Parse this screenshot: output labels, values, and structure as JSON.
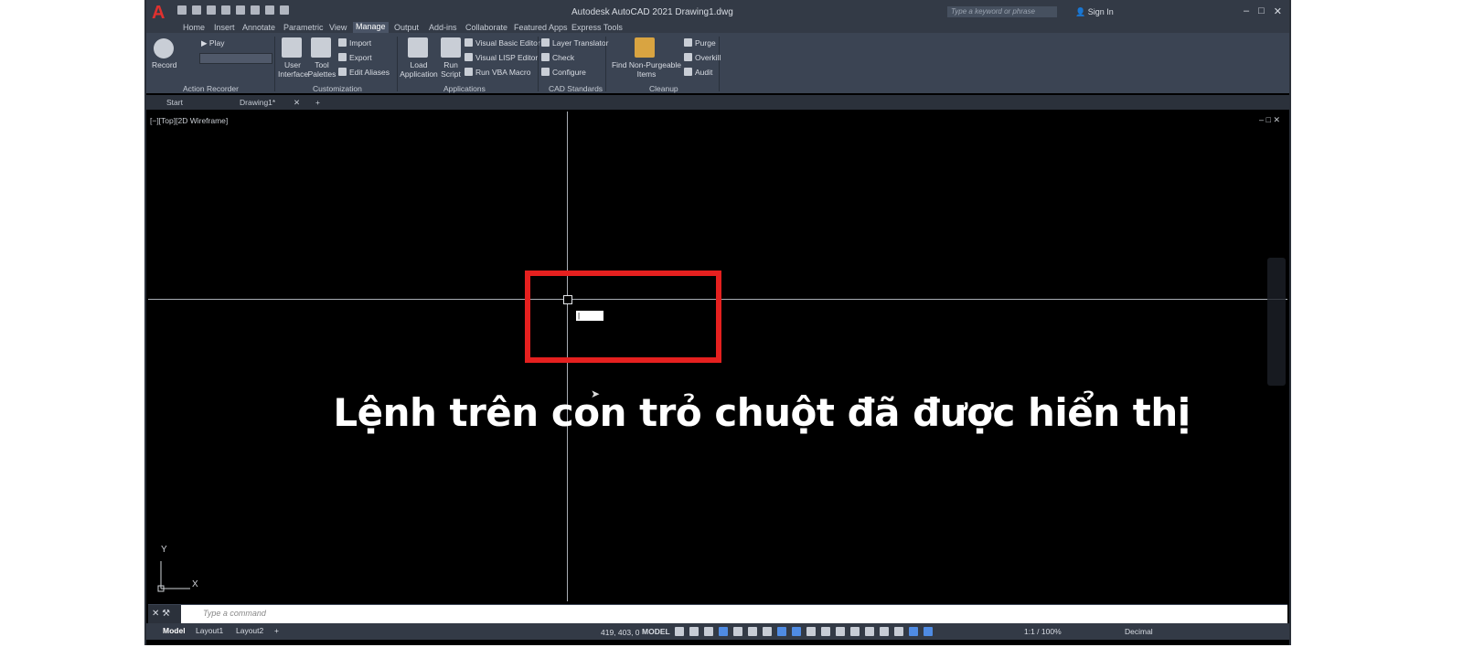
{
  "app": {
    "title": "Autodesk AutoCAD 2021   Drawing1.dwg",
    "logo_letter": "A",
    "search_placeholder": "Type a keyword or phrase",
    "sign_in": "Sign In"
  },
  "ribbon_tabs": [
    "Home",
    "Insert",
    "Annotate",
    "Parametric",
    "View",
    "Manage",
    "Output",
    "Add-ins",
    "Collaborate",
    "Featured Apps",
    "Express Tools"
  ],
  "active_tab": "Manage",
  "ribbon": {
    "record": "Record",
    "play": "Play",
    "user_interface": "User Interface",
    "tool_palettes": "Tool Palettes",
    "import": "Import",
    "export": "Export",
    "edit_aliases": "Edit Aliases",
    "load_application": "Load Application",
    "run_script": "Run Script",
    "visual_basic_editor": "Visual Basic Editor",
    "visual_lisp_editor": "Visual LISP Editor",
    "run_vba_macro": "Run VBA Macro",
    "layer_translator": "Layer Translator",
    "check": "Check",
    "configure": "Configure",
    "find_non_purgeable": "Find Non-Purgeable Items",
    "purge": "Purge",
    "overkill": "Overkill",
    "audit": "Audit",
    "panel_action_recorder": "Action Recorder",
    "panel_customization": "Customization",
    "panel_applications": "Applications",
    "panel_cad_standards": "CAD Standards",
    "panel_cleanup": "Cleanup"
  },
  "doc_tabs": {
    "start": "Start",
    "drawing": "Drawing1*"
  },
  "viewport": {
    "label": "[−][Top][2D Wireframe]",
    "dynamic_input": "|",
    "caption": "Lệnh trên con trỏ chuột đã được hiển thị",
    "ucs_x": "X",
    "ucs_y": "Y",
    "highlight_color": "#e5201f"
  },
  "command": {
    "placeholder": "Type a command"
  },
  "status": {
    "layout_tabs": [
      "Model",
      "Layout1",
      "Layout2"
    ],
    "coords": "419, 403, 0",
    "model": "MODEL",
    "scale": "1:1 / 100%",
    "units": "Decimal"
  }
}
